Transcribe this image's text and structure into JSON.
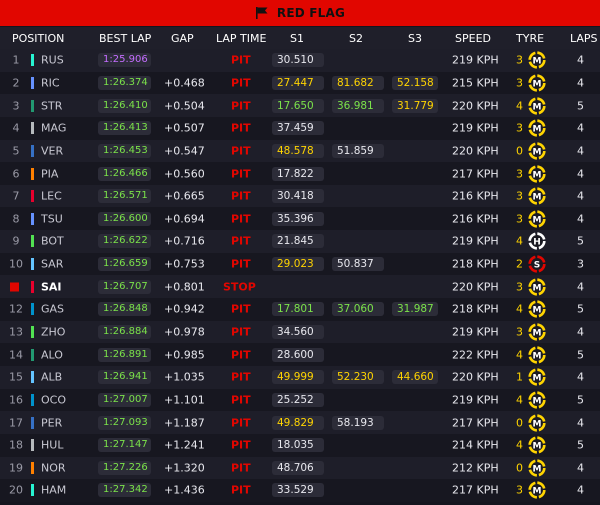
{
  "banner": {
    "title": "RED FLAG"
  },
  "columns": {
    "position": "POSITION",
    "best_lap": "BEST LAP",
    "gap": "GAP",
    "lap_time": "LAP TIME",
    "s1": "S1",
    "s2": "S2",
    "s3": "S3",
    "speed": "SPEED",
    "tyre": "TYRE",
    "laps": "LAPS"
  },
  "tyre_letters": {
    "medium": "M",
    "hard": "H",
    "soft": "S"
  },
  "colors": {
    "red": "#e10600",
    "green": "#7be24a",
    "purple": "#c46dff",
    "yellow": "#ffd400"
  },
  "rows": [
    {
      "pos": "1",
      "driver": "RUS",
      "team": "#27f4d2",
      "best": "1:25.906",
      "best_style": "purple",
      "gap": "",
      "status": "PIT",
      "s1": "30.510",
      "s1c": "",
      "s2": "",
      "s2c": "",
      "s3": "",
      "s3c": "",
      "speed": "219 KPH",
      "age": "3",
      "tyre": "medium",
      "laps": "4"
    },
    {
      "pos": "2",
      "driver": "RIC",
      "team": "#6692ff",
      "best": "1:26.374",
      "best_style": "green",
      "gap": "+0.468",
      "status": "PIT",
      "s1": "27.447",
      "s1c": "yellow",
      "s2": "81.682",
      "s2c": "yellow",
      "s3": "52.158",
      "s3c": "yellow",
      "speed": "215 KPH",
      "age": "3",
      "tyre": "medium",
      "laps": "4"
    },
    {
      "pos": "3",
      "driver": "STR",
      "team": "#229971",
      "best": "1:26.410",
      "best_style": "green",
      "gap": "+0.504",
      "status": "PIT",
      "s1": "17.650",
      "s1c": "green",
      "s2": "36.981",
      "s2c": "green",
      "s3": "31.779",
      "s3c": "yellow",
      "speed": "220 KPH",
      "age": "4",
      "tyre": "medium",
      "laps": "5"
    },
    {
      "pos": "4",
      "driver": "MAG",
      "team": "#b6babd",
      "best": "1:26.413",
      "best_style": "green",
      "gap": "+0.507",
      "status": "PIT",
      "s1": "37.459",
      "s1c": "",
      "s2": "",
      "s2c": "",
      "s3": "",
      "s3c": "",
      "speed": "219 KPH",
      "age": "3",
      "tyre": "medium",
      "laps": "4"
    },
    {
      "pos": "5",
      "driver": "VER",
      "team": "#3671c6",
      "best": "1:26.453",
      "best_style": "green",
      "gap": "+0.547",
      "status": "PIT",
      "s1": "48.578",
      "s1c": "yellow",
      "s2": "51.859",
      "s2c": "",
      "s3": "",
      "s3c": "",
      "speed": "220 KPH",
      "age": "0",
      "tyre": "medium",
      "laps": "4"
    },
    {
      "pos": "6",
      "driver": "PIA",
      "team": "#ff8000",
      "best": "1:26.466",
      "best_style": "green",
      "gap": "+0.560",
      "status": "PIT",
      "s1": "17.822",
      "s1c": "",
      "s2": "",
      "s2c": "",
      "s3": "",
      "s3c": "",
      "speed": "217 KPH",
      "age": "3",
      "tyre": "medium",
      "laps": "4"
    },
    {
      "pos": "7",
      "driver": "LEC",
      "team": "#e8002d",
      "best": "1:26.571",
      "best_style": "green",
      "gap": "+0.665",
      "status": "PIT",
      "s1": "30.418",
      "s1c": "",
      "s2": "",
      "s2c": "",
      "s3": "",
      "s3c": "",
      "speed": "216 KPH",
      "age": "3",
      "tyre": "medium",
      "laps": "4"
    },
    {
      "pos": "8",
      "driver": "TSU",
      "team": "#6692ff",
      "best": "1:26.600",
      "best_style": "green",
      "gap": "+0.694",
      "status": "PIT",
      "s1": "35.396",
      "s1c": "",
      "s2": "",
      "s2c": "",
      "s3": "",
      "s3c": "",
      "speed": "216 KPH",
      "age": "3",
      "tyre": "medium",
      "laps": "4"
    },
    {
      "pos": "9",
      "driver": "BOT",
      "team": "#52e252",
      "best": "1:26.622",
      "best_style": "green",
      "gap": "+0.716",
      "status": "PIT",
      "s1": "21.845",
      "s1c": "",
      "s2": "",
      "s2c": "",
      "s3": "",
      "s3c": "",
      "speed": "219 KPH",
      "age": "4",
      "tyre": "hard",
      "laps": "5"
    },
    {
      "pos": "10",
      "driver": "SAR",
      "team": "#64c4ff",
      "best": "1:26.659",
      "best_style": "green",
      "gap": "+0.753",
      "status": "PIT",
      "s1": "29.023",
      "s1c": "yellow",
      "s2": "50.837",
      "s2c": "",
      "s3": "",
      "s3c": "",
      "speed": "218 KPH",
      "age": "2",
      "tyre": "soft",
      "laps": "3"
    },
    {
      "pos": "",
      "driver": "SAI",
      "team": "#e8002d",
      "best": "1:26.707",
      "best_style": "green",
      "gap": "+0.801",
      "status": "STOP",
      "s1": "",
      "s1c": "",
      "s2": "",
      "s2c": "",
      "s3": "",
      "s3c": "",
      "speed": "220 KPH",
      "age": "3",
      "tyre": "medium",
      "laps": "4"
    },
    {
      "pos": "12",
      "driver": "GAS",
      "team": "#0093cc",
      "best": "1:26.848",
      "best_style": "green",
      "gap": "+0.942",
      "status": "PIT",
      "s1": "17.801",
      "s1c": "green",
      "s2": "37.060",
      "s2c": "green",
      "s3": "31.987",
      "s3c": "green",
      "speed": "218 KPH",
      "age": "4",
      "tyre": "medium",
      "laps": "5"
    },
    {
      "pos": "13",
      "driver": "ZHO",
      "team": "#52e252",
      "best": "1:26.884",
      "best_style": "green",
      "gap": "+0.978",
      "status": "PIT",
      "s1": "34.560",
      "s1c": "",
      "s2": "",
      "s2c": "",
      "s3": "",
      "s3c": "",
      "speed": "219 KPH",
      "age": "3",
      "tyre": "medium",
      "laps": "4"
    },
    {
      "pos": "14",
      "driver": "ALO",
      "team": "#229971",
      "best": "1:26.891",
      "best_style": "green",
      "gap": "+0.985",
      "status": "PIT",
      "s1": "28.600",
      "s1c": "",
      "s2": "",
      "s2c": "",
      "s3": "",
      "s3c": "",
      "speed": "222 KPH",
      "age": "4",
      "tyre": "medium",
      "laps": "5"
    },
    {
      "pos": "15",
      "driver": "ALB",
      "team": "#64c4ff",
      "best": "1:26.941",
      "best_style": "green",
      "gap": "+1.035",
      "status": "PIT",
      "s1": "49.999",
      "s1c": "yellow",
      "s2": "52.230",
      "s2c": "yellow",
      "s3": "44.660",
      "s3c": "yellow",
      "speed": "220 KPH",
      "age": "1",
      "tyre": "medium",
      "laps": "4"
    },
    {
      "pos": "16",
      "driver": "OCO",
      "team": "#0093cc",
      "best": "1:27.007",
      "best_style": "green",
      "gap": "+1.101",
      "status": "PIT",
      "s1": "25.252",
      "s1c": "",
      "s2": "",
      "s2c": "",
      "s3": "",
      "s3c": "",
      "speed": "219 KPH",
      "age": "4",
      "tyre": "medium",
      "laps": "5"
    },
    {
      "pos": "17",
      "driver": "PER",
      "team": "#3671c6",
      "best": "1:27.093",
      "best_style": "green",
      "gap": "+1.187",
      "status": "PIT",
      "s1": "49.829",
      "s1c": "yellow",
      "s2": "58.193",
      "s2c": "",
      "s3": "",
      "s3c": "",
      "speed": "217 KPH",
      "age": "0",
      "tyre": "medium",
      "laps": "4"
    },
    {
      "pos": "18",
      "driver": "HUL",
      "team": "#b6babd",
      "best": "1:27.147",
      "best_style": "green",
      "gap": "+1.241",
      "status": "PIT",
      "s1": "18.035",
      "s1c": "",
      "s2": "",
      "s2c": "",
      "s3": "",
      "s3c": "",
      "speed": "214 KPH",
      "age": "4",
      "tyre": "medium",
      "laps": "5"
    },
    {
      "pos": "19",
      "driver": "NOR",
      "team": "#ff8000",
      "best": "1:27.226",
      "best_style": "green",
      "gap": "+1.320",
      "status": "PIT",
      "s1": "48.706",
      "s1c": "",
      "s2": "",
      "s2c": "",
      "s3": "",
      "s3c": "",
      "speed": "212 KPH",
      "age": "0",
      "tyre": "medium",
      "laps": "4"
    },
    {
      "pos": "20",
      "driver": "HAM",
      "team": "#27f4d2",
      "best": "1:27.342",
      "best_style": "green",
      "gap": "+1.436",
      "status": "PIT",
      "s1": "33.529",
      "s1c": "",
      "s2": "",
      "s2c": "",
      "s3": "",
      "s3c": "",
      "speed": "217 KPH",
      "age": "3",
      "tyre": "medium",
      "laps": "4"
    }
  ]
}
